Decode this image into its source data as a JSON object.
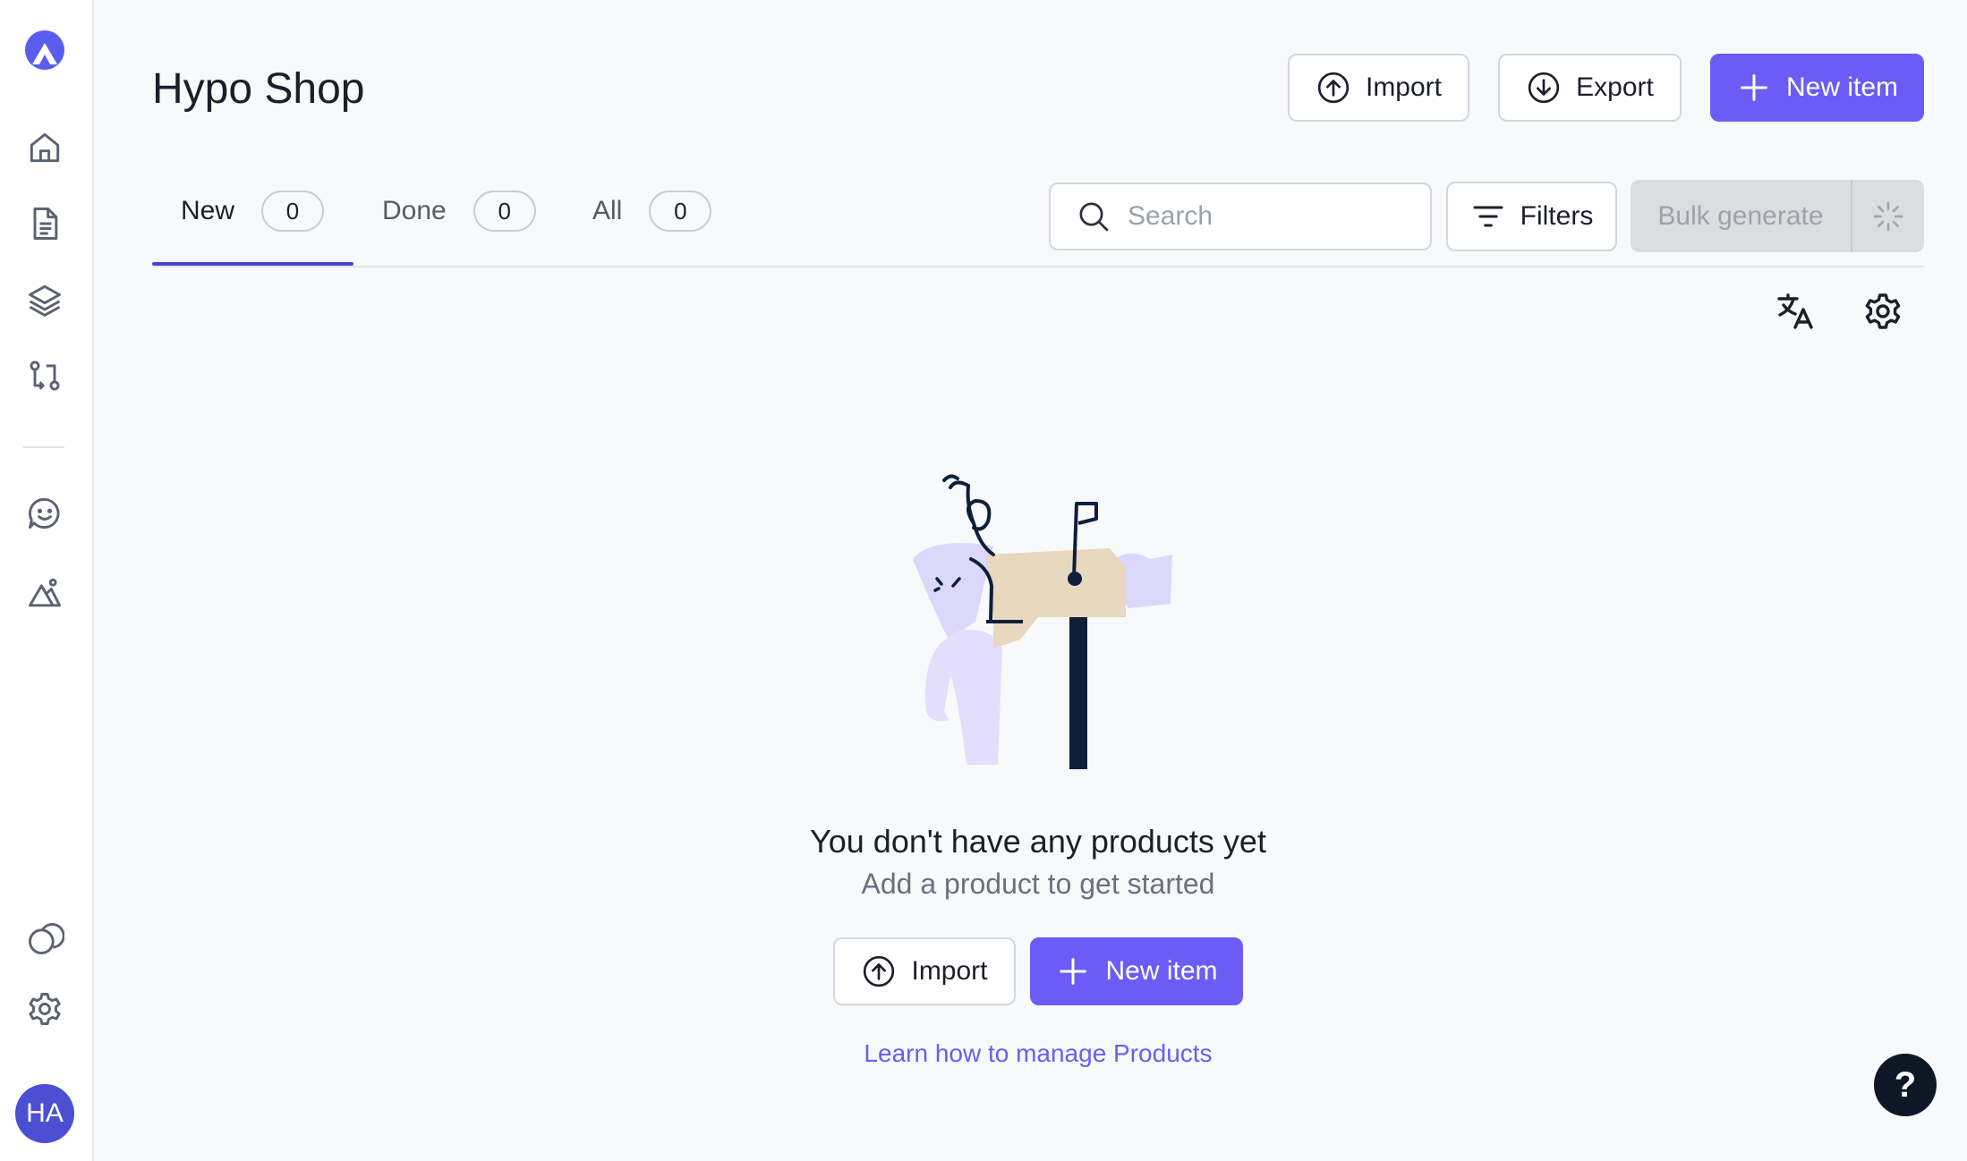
{
  "header": {
    "title": "Hypo Shop",
    "import_label": "Import",
    "export_label": "Export",
    "new_item_label": "New item"
  },
  "tabs": [
    {
      "label": "New",
      "count": "0"
    },
    {
      "label": "Done",
      "count": "0"
    },
    {
      "label": "All",
      "count": "0"
    }
  ],
  "toolbar": {
    "search_placeholder": "Search",
    "filters_label": "Filters",
    "bulk_generate_label": "Bulk generate"
  },
  "empty_state": {
    "title": "You don't have any products yet",
    "subtitle": "Add a product to get started",
    "import_label": "Import",
    "new_item_label": "New item",
    "learn_link": "Learn how to manage Products"
  },
  "sidebar": {
    "items": [
      {
        "icon": "home-icon"
      },
      {
        "icon": "document-icon"
      },
      {
        "icon": "layers-icon"
      },
      {
        "icon": "workflow-icon"
      },
      {
        "icon": "chat-smile-icon"
      },
      {
        "icon": "image-icon"
      },
      {
        "icon": "circles-icon"
      },
      {
        "icon": "gear-icon"
      }
    ],
    "avatar_initials": "HA"
  },
  "help_label": "?",
  "colors": {
    "accent": "#6b5cf5",
    "tab_underline": "#4e3fd6",
    "avatar": "#4b4fd1",
    "help_button": "#0e1726"
  }
}
